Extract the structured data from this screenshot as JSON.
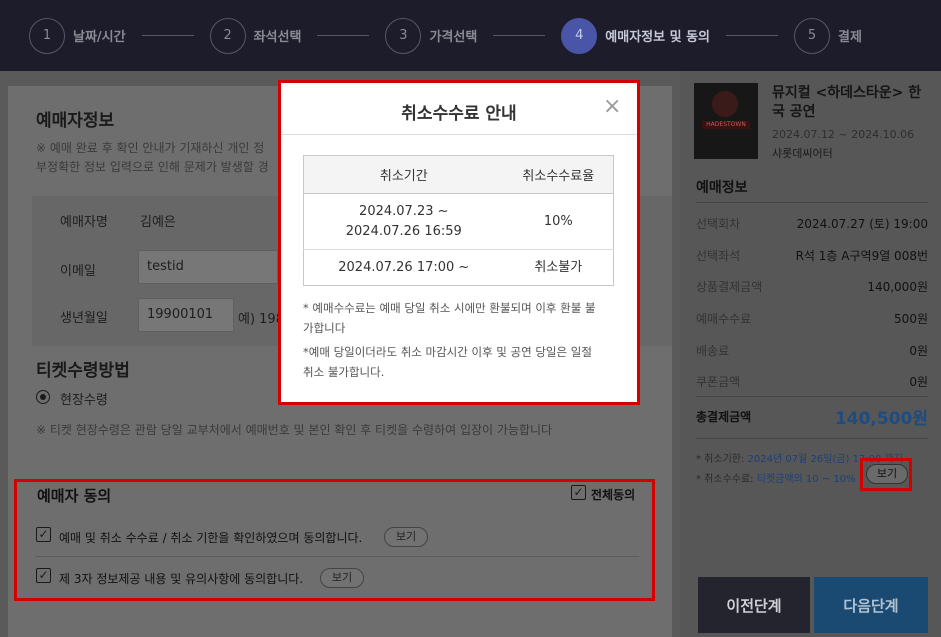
{
  "steps": [
    {
      "num": "1",
      "label": "날짜/시간"
    },
    {
      "num": "2",
      "label": "좌석선택"
    },
    {
      "num": "3",
      "label": "가격선택"
    },
    {
      "num": "4",
      "label": "예매자정보 및 동의"
    },
    {
      "num": "5",
      "label": "결제"
    }
  ],
  "booker": {
    "title": "예매자정보",
    "note1": "※ 예매 완료 후 확인 안내가 기재하신 개인 정",
    "note2": "부정확한 정보 입력으로 인해 문제가 발생할 경",
    "name_label": "예매자명",
    "name_value": "김예은",
    "email_label": "이메일",
    "email_value": "testid",
    "birth_label": "생년월일",
    "birth_value": "19900101",
    "birth_hint": "예) 198"
  },
  "ticket": {
    "title": "티켓수령방법",
    "option": "현장수령",
    "note": "※ 티켓 현장수령은 관람 당일 교부처에서 예매번호 및 본인 확인 후 티켓을 수령하여 입장이 가능합니다"
  },
  "agree": {
    "title": "예매자 동의",
    "all_label": "전체동의",
    "item1": "예매 및 취소 수수료 / 취소 기한을 확인하였으며 동의합니다.",
    "item2": "제 3자 정보제공 내용 및 유의사항에 동의합니다.",
    "view": "보기"
  },
  "side": {
    "show_title": "뮤지컬 <하데스타운> 한국 공연",
    "show_date": "2024.07.12 ~ 2024.10.06",
    "venue": "샤롯데씨어터",
    "poster_text": "HADESTOWN",
    "info_head": "예매정보",
    "rows": [
      {
        "k": "선택회차",
        "v": "2024.07.27 (토) 19:00"
      },
      {
        "k": "선택좌석",
        "v": "R석 1층 A구역9열 008번"
      },
      {
        "k": "상품결제금액",
        "v": "140,000원"
      },
      {
        "k": "예매수수료",
        "v": "500원"
      },
      {
        "k": "배송료",
        "v": "0원"
      },
      {
        "k": "쿠폰금액",
        "v": "0원"
      }
    ],
    "total_label": "총결제금액",
    "total_value": "140,500원",
    "cancel_deadline_label": "* 취소기한:",
    "cancel_deadline_value": "2024년 07월 26일(금) 17:00 까지",
    "cancel_fee_label": "* 취소수수료:",
    "cancel_fee_value": "티켓금액의 10 ~ 10%",
    "view": "보기",
    "prev": "이전단계",
    "next": "다음단계"
  },
  "modal": {
    "title": "취소수수료 안내",
    "close": "×",
    "col1": "취소기간",
    "col2": "취소수수료율",
    "r1_period_a": "2024.07.23 ~",
    "r1_period_b": "2024.07.26 16:59",
    "r1_rate": "10%",
    "r2_period": "2024.07.26 17:00 ~",
    "r2_rate": "취소불가",
    "note1a": "* 예매수수료는 예매 당일 취소 시에만 환불되며 이후 환불 불",
    "note1b": "가합니다",
    "note2a": "*예매 당일이더라도 취소 마감시간 이후 및 공연 당일은 일절",
    "note2b": "취소 불가합니다."
  }
}
